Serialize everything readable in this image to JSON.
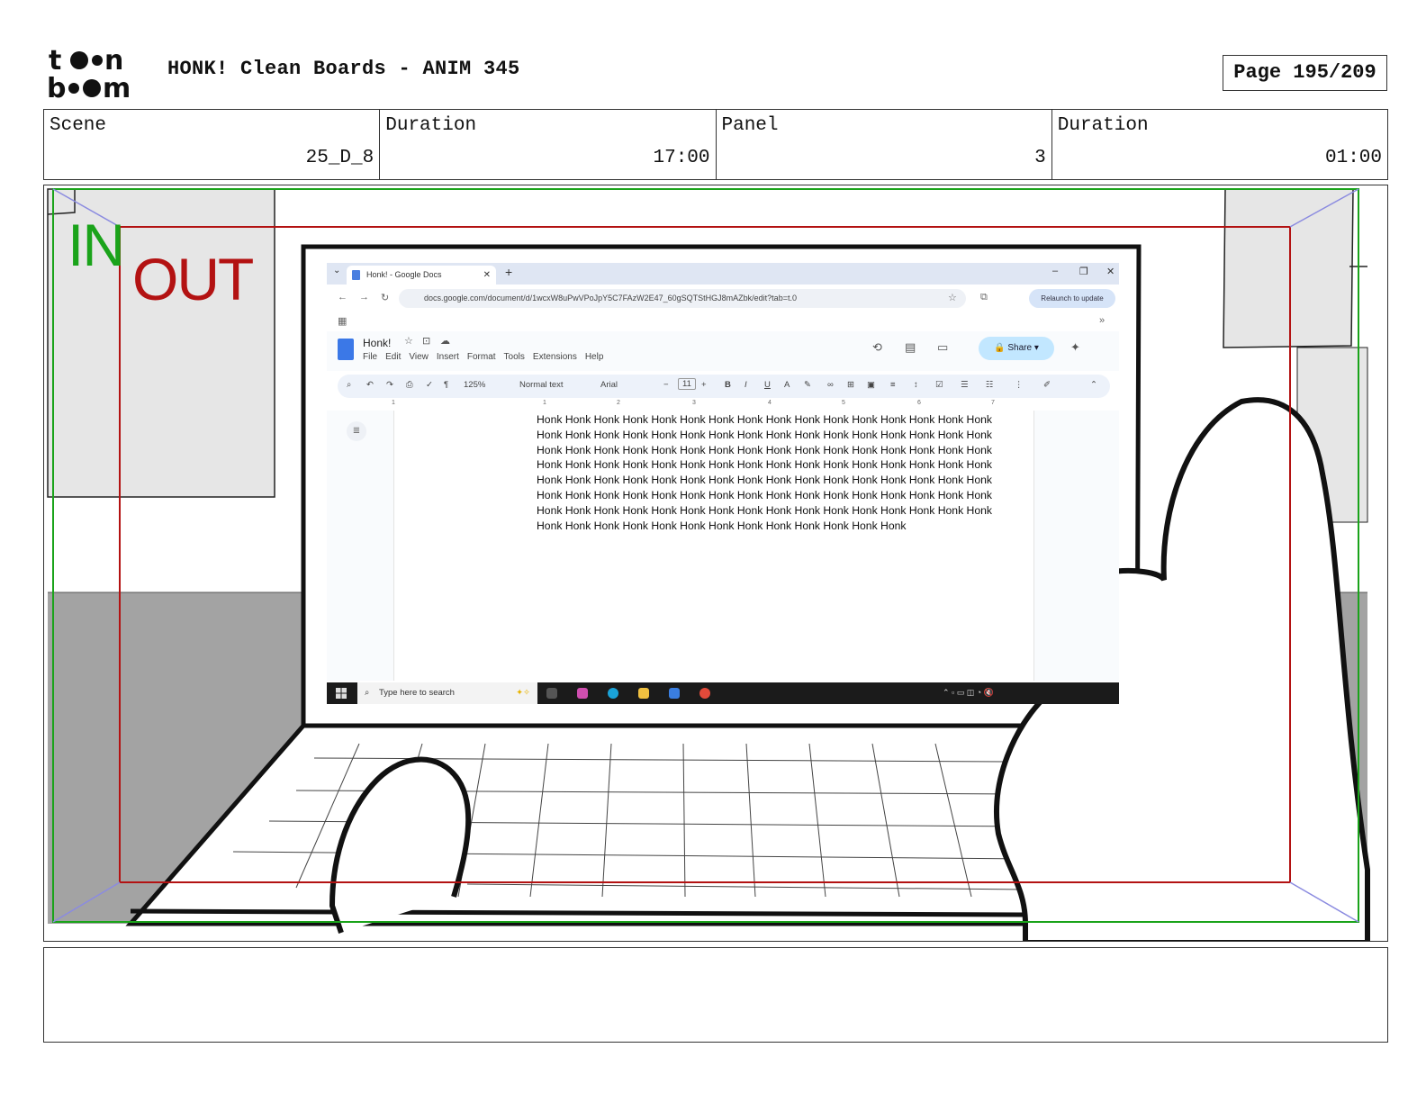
{
  "header": {
    "logo_text": "toon boom",
    "title": "HONK! Clean Boards - ANIM 345",
    "page_label": "Page 195/209"
  },
  "info": [
    {
      "label": "Scene",
      "value": "25_D_8"
    },
    {
      "label": "Duration",
      "value": "17:00"
    },
    {
      "label": "Panel",
      "value": "3"
    },
    {
      "label": "Duration",
      "value": "01:00"
    }
  ],
  "panel": {
    "safe_in_label": "IN",
    "safe_out_label": "OUT",
    "colors": {
      "in_frame": "#1aa31a",
      "out_frame": "#b31212",
      "wall_gray": "#a3a3a3",
      "poster_gray": "#e6e6e6"
    },
    "screen": {
      "tab_title": "Honk! - Google Docs",
      "url": "docs.google.com/document/d/1wcxW8uPwVPoJpY5C7FAzW2E47_60gSQTStHGJ8mAZbk/edit?tab=t.0",
      "relaunch": "Relaunch to update",
      "doc_title": "Honk!",
      "menu": [
        "File",
        "Edit",
        "View",
        "Insert",
        "Format",
        "Tools",
        "Extensions",
        "Help"
      ],
      "share": "Share",
      "zoom": "125%",
      "style": "Normal text",
      "font": "Arial",
      "font_size": "11",
      "ruler_marks": [
        "1",
        "1",
        "2",
        "3",
        "4",
        "5",
        "6",
        "7"
      ],
      "body_lines": [
        "Honk Honk Honk Honk Honk Honk Honk Honk Honk Honk Honk Honk Honk Honk Honk Honk",
        "Honk Honk Honk Honk Honk Honk Honk Honk Honk Honk Honk Honk Honk Honk Honk Honk",
        "Honk Honk Honk Honk Honk Honk Honk Honk Honk Honk Honk Honk Honk Honk Honk Honk",
        "Honk Honk Honk Honk Honk Honk Honk Honk Honk Honk Honk Honk Honk Honk Honk Honk",
        "Honk Honk Honk Honk Honk Honk Honk Honk Honk Honk Honk Honk Honk Honk Honk Honk",
        "Honk Honk Honk Honk Honk Honk Honk Honk Honk Honk Honk Honk Honk Honk Honk Honk",
        "Honk Honk Honk Honk Honk Honk Honk Honk Honk Honk Honk Honk Honk Honk Honk Honk",
        "Honk Honk Honk Honk Honk Honk Honk Honk Honk Honk Honk Honk Honk"
      ],
      "taskbar_search": "Type here to search"
    }
  }
}
